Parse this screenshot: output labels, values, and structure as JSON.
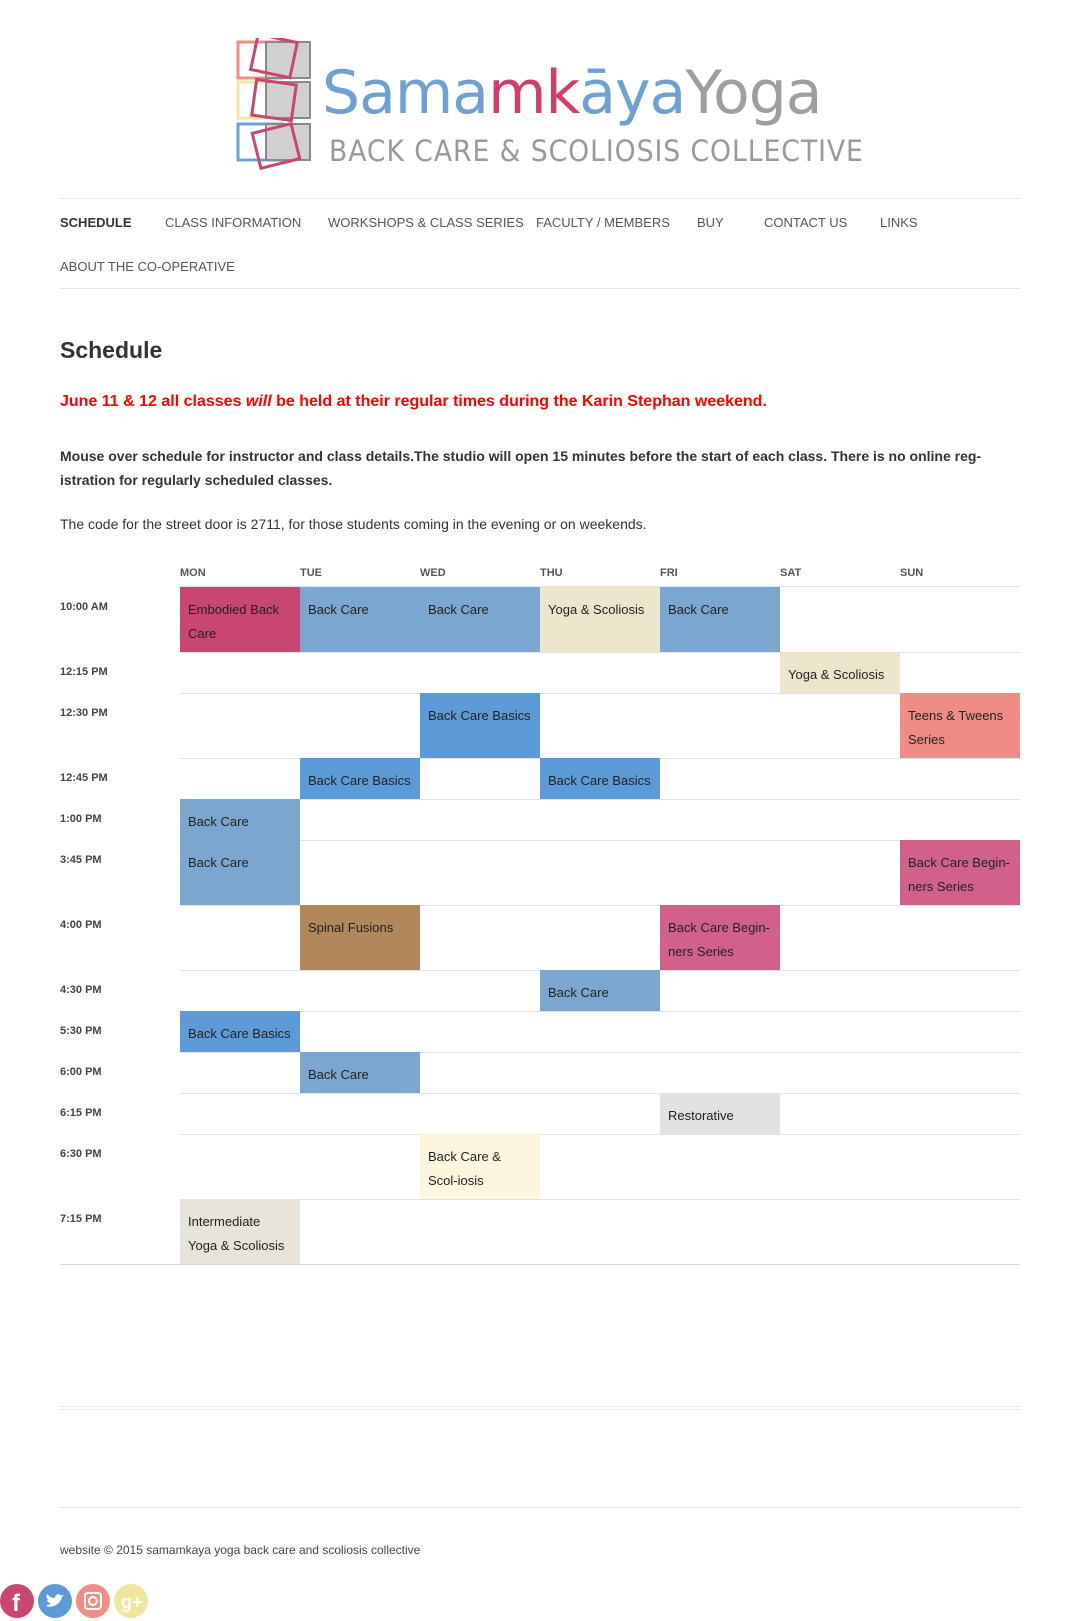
{
  "brand": {
    "name_parts": [
      {
        "text": "Sama",
        "color": "#6fa0d4"
      },
      {
        "text": "m",
        "color": "#d43d6a"
      },
      {
        "text": "k",
        "color": "#d43d6a"
      },
      {
        "text": "āya",
        "color": "#6fa0d4"
      },
      {
        "text": "Yoga",
        "color": "#9e9e9e"
      }
    ],
    "subtitle": "BACK CARE & SCOLIOSIS COLLECTIVE"
  },
  "nav": {
    "items": [
      {
        "label": "SCHEDULE"
      },
      {
        "label": "CLASS INFORMATION"
      },
      {
        "label": "WORKSHOPS & CLASS SERIES"
      },
      {
        "label": "FACULTY / MEMBERS"
      },
      {
        "label": "BUY"
      },
      {
        "label": "CONTACT US"
      },
      {
        "label": "LINKS"
      },
      {
        "label": "ABOUT THE CO-OPERATIVE"
      }
    ]
  },
  "page": {
    "title": "Schedule",
    "alert_before": "June 11 & 12 all classes ",
    "alert_em": "will",
    "alert_after": " be held at their regular times during the Karin Stephan weekend.",
    "info_line1": "Mouse over schedule for instructor and class details.The studio will open 15 minutes before the start of each class. There is no online reg-",
    "info_line2": "istration for regularly scheduled classes.",
    "door_note": "The code for the street door is 2711, for those students coming in the evening or on weekends."
  },
  "schedule": {
    "days": [
      "MON",
      "TUE",
      "WED",
      "THU",
      "FRI",
      "SAT",
      "SUN"
    ],
    "times": [
      "10:00 AM",
      "12:15 PM",
      "12:30 PM",
      "12:45 PM",
      "1:00 PM",
      "3:45 PM",
      "4:00 PM",
      "4:30 PM",
      "5:30 PM",
      "6:00 PM",
      "6:15 PM",
      "6:30 PM",
      "7:15 PM"
    ],
    "classes": [
      {
        "time": 0,
        "day": 0,
        "name": "Embodied Back Care",
        "color": "#c94670"
      },
      {
        "time": 0,
        "day": 1,
        "name": "Back Care",
        "color": "#7aa6cf"
      },
      {
        "time": 0,
        "day": 2,
        "name": "Back Care",
        "color": "#7aa6cf"
      },
      {
        "time": 0,
        "day": 3,
        "name": "Yoga & Scoliosis",
        "color": "#ece5cb"
      },
      {
        "time": 0,
        "day": 4,
        "name": "Back Care",
        "color": "#7aa6cf"
      },
      {
        "time": 1,
        "day": 5,
        "name": "Yoga & Scoliosis",
        "color": "#ece5cb"
      },
      {
        "time": 2,
        "day": 2,
        "name": "Back Care Basics",
        "color": "#5d9ad8"
      },
      {
        "time": 2,
        "day": 6,
        "name": "Teens & Tweens Series",
        "color": "#ee8c85"
      },
      {
        "time": 3,
        "day": 1,
        "name": "Back Care Basics",
        "color": "#5d9ad8"
      },
      {
        "time": 3,
        "day": 3,
        "name": "Back Care Basics",
        "color": "#5d9ad8"
      },
      {
        "time": 4,
        "day": 0,
        "name": "Back Care",
        "color": "#7aa6cf"
      },
      {
        "time": 5,
        "day": 0,
        "name": "Back Care",
        "color": "#7aa6cf"
      },
      {
        "time": 5,
        "day": 6,
        "name": "Back Care Begin-ners Series",
        "color": "#d1618b"
      },
      {
        "time": 6,
        "day": 1,
        "name": "Spinal Fusions",
        "color": "#b2875b"
      },
      {
        "time": 6,
        "day": 4,
        "name": "Back Care Begin-ners Series",
        "color": "#d1618b"
      },
      {
        "time": 7,
        "day": 3,
        "name": "Back Care",
        "color": "#7aa6cf"
      },
      {
        "time": 8,
        "day": 0,
        "name": "Back Care Basics",
        "color": "#5d9ad8"
      },
      {
        "time": 9,
        "day": 1,
        "name": "Back Care",
        "color": "#7aa6cf"
      },
      {
        "time": 10,
        "day": 4,
        "name": "Restorative",
        "color": "#e2e2e2"
      },
      {
        "time": 11,
        "day": 2,
        "name": "Back Care & Scol-iosis",
        "color": "#fcf6de"
      },
      {
        "time": 12,
        "day": 0,
        "name": "Intermediate Yoga & Scoliosis",
        "color": "#e5e3da"
      }
    ]
  },
  "footer": {
    "copyright": "website © 2015 samamkaya yoga back care and scoliosis collective"
  },
  "social": [
    {
      "icon": "facebook-icon",
      "color": "#c94670"
    },
    {
      "icon": "twitter-icon",
      "color": "#5d9ad8"
    },
    {
      "icon": "instagram-icon",
      "color": "#ee8c85"
    },
    {
      "icon": "google-plus-icon",
      "color": "#f0e6a0"
    }
  ]
}
